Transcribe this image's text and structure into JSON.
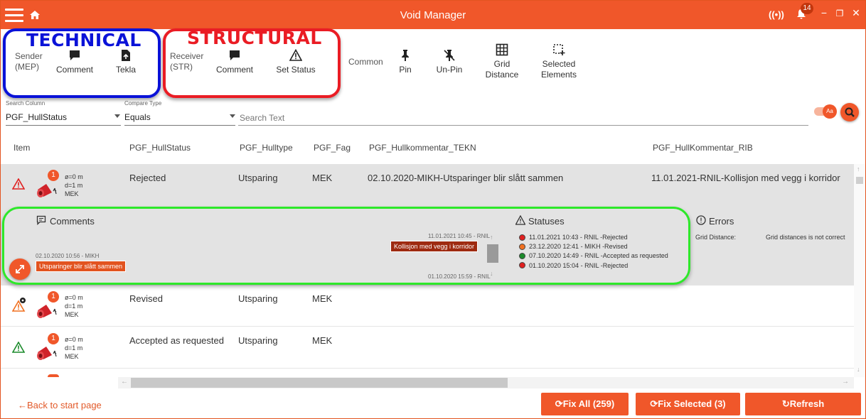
{
  "window": {
    "title": "Void Manager",
    "notification_count": "14",
    "connectivity_label": "((•))",
    "minimize": "−",
    "restore": "❐",
    "close": "✕"
  },
  "toolbar": {
    "technical": {
      "title": "TECHNICAL",
      "sender_label": "Sender (MEP)",
      "comment": "Comment",
      "tekla": "Tekla"
    },
    "structural": {
      "title": "STRUCTURAL",
      "receiver_label": "Receiver (STR)",
      "comment": "Comment",
      "set_status": "Set Status"
    },
    "common": {
      "label": "Common",
      "pin": "Pin",
      "unpin": "Un-Pin",
      "grid_distance": "Grid Distance",
      "selected_elements": "Selected Elements"
    }
  },
  "search": {
    "column_caption": "Search Column",
    "column_value": "PGF_HullStatus",
    "compare_caption": "Compare Type",
    "compare_value": "Equals",
    "text_placeholder": "Search Text"
  },
  "table": {
    "headers": [
      "Item",
      "PGF_HullStatus",
      "PGF_Hulltype",
      "PGF_Fag",
      "PGF_Hullkommentar_TEKN",
      "PGF_HullKommentar_RIB"
    ],
    "rows": [
      {
        "badge": "1",
        "dims": [
          "ø=0 m",
          "d=1 m",
          "MEK"
        ],
        "status": "Rejected",
        "type": "Utsparing",
        "fag": "MEK",
        "tekn": "02.10.2020-MIKH-Utsparinger blir slått sammen",
        "rib": "11.01.2021-RNIL-Kollisjon med vegg i korridor"
      },
      {
        "badge": "1",
        "dims": [
          "ø=0 m",
          "d=1 m",
          "MEK"
        ],
        "status": "Revised",
        "type": "Utsparing",
        "fag": "MEK",
        "tekn": "",
        "rib": ""
      },
      {
        "badge": "1",
        "dims": [
          "ø=0 m",
          "d=1 m",
          "MEK"
        ],
        "status": "Accepted as requested",
        "type": "Utsparing",
        "fag": "MEK",
        "tekn": "",
        "rib": ""
      }
    ]
  },
  "details": {
    "comments_title": "Comments",
    "comment_left_meta": "02.10.2020 10:56 - MIKH",
    "comment_left_text": "Utsparinger blir slått sammen",
    "comment_right_meta": "11.01.2021 10:45 - RNIL",
    "comment_right_text": "Kollisjon med vegg i korridor",
    "comment_bottom_meta": "01.10.2020 15:59 - RNIL",
    "statuses_title": "Statuses",
    "statuses": [
      {
        "text": "11.01.2021 10:43 - RNIL -Rejected",
        "color": "#e02020"
      },
      {
        "text": "23.12.2020 12:41 - MIKH -Revised",
        "color": "#f07020"
      },
      {
        "text": "07.10.2020 14:49 - RNIL -Accepted as requested",
        "color": "#1a8a2a"
      },
      {
        "text": "01.10.2020 15:04 - RNIL -Rejected",
        "color": "#e02020"
      }
    ],
    "errors_title": "Errors",
    "error_key": "Grid Distance:",
    "error_value": "Grid distances is not correct"
  },
  "footer": {
    "back": "Back to start page",
    "fix_all": "Fix All (259)",
    "fix_selected": "Fix Selected (3)",
    "refresh": "Refresh"
  },
  "colors": {
    "accent": "#f0572a",
    "technical_box": "#0a12d8",
    "structural_box": "#ea1c24",
    "details_box": "#2ee82a"
  }
}
